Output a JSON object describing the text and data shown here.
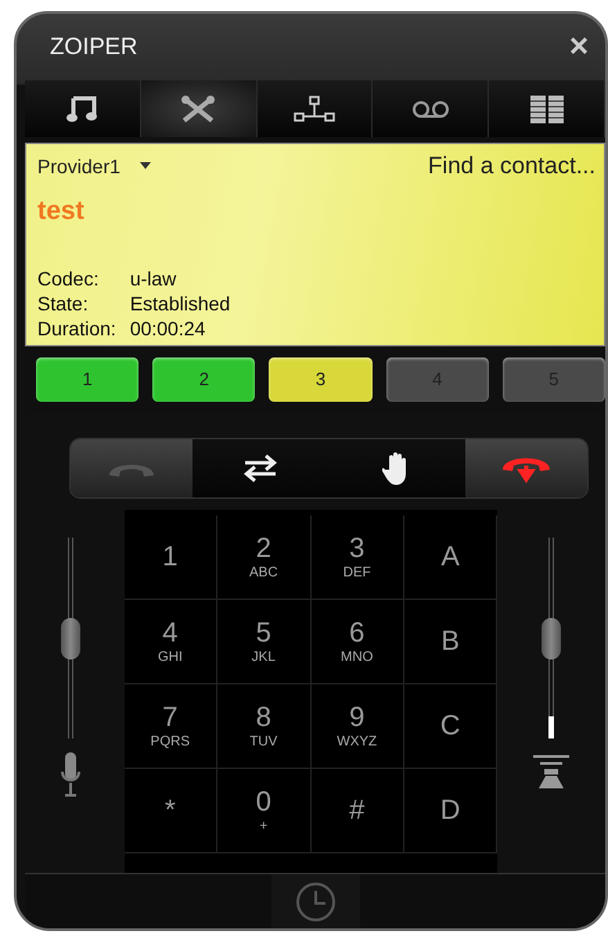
{
  "window": {
    "title": "ZOIPER",
    "close": "×"
  },
  "tabs": [
    {
      "kind": "music",
      "selected": false
    },
    {
      "kind": "tools",
      "selected": true
    },
    {
      "kind": "network",
      "selected": false
    },
    {
      "kind": "voicemail",
      "selected": false
    },
    {
      "kind": "columns",
      "selected": false
    }
  ],
  "call_panel": {
    "provider": "Provider1",
    "search": {
      "placeholder": "Find a contact..."
    },
    "contact": "test",
    "info": [
      {
        "label": "Codec:",
        "value": "u-law"
      },
      {
        "label": "State:",
        "value": "Established"
      },
      {
        "label": "Duration:",
        "value": "00:00:24"
      }
    ]
  },
  "lines": [
    {
      "label": "1",
      "color": "#2fc42f"
    },
    {
      "label": "2",
      "color": "#2fc42f"
    },
    {
      "label": "3",
      "color": "#d8d83a"
    },
    {
      "label": "4",
      "color": "#4a4a4a"
    },
    {
      "label": "5",
      "color": "#4a4a4a"
    }
  ],
  "actions": [
    {
      "kind": "answer",
      "disabled": true
    },
    {
      "kind": "transfer",
      "disabled": false
    },
    {
      "kind": "hold",
      "disabled": false
    },
    {
      "kind": "hangup",
      "disabled": false
    }
  ],
  "microphone": {
    "level": 0.5
  },
  "speaker": {
    "level": 0.5
  },
  "keypad": [
    {
      "digit": "1"
    },
    {
      "digit": "2",
      "letters": "ABC"
    },
    {
      "digit": "3",
      "letters": "DEF"
    },
    {
      "digit": "A"
    },
    {
      "digit": "4",
      "letters": "GHI"
    },
    {
      "digit": "5",
      "letters": "JKL"
    },
    {
      "digit": "6",
      "letters": "MNO"
    },
    {
      "digit": "B"
    },
    {
      "digit": "7",
      "letters": "PQRS"
    },
    {
      "digit": "8",
      "letters": "TUV"
    },
    {
      "digit": "9",
      "letters": "WXYZ"
    },
    {
      "digit": "C"
    },
    {
      "digit": "*"
    },
    {
      "digit": "0",
      "letters": "+"
    },
    {
      "digit": "#"
    },
    {
      "digit": "D"
    }
  ]
}
